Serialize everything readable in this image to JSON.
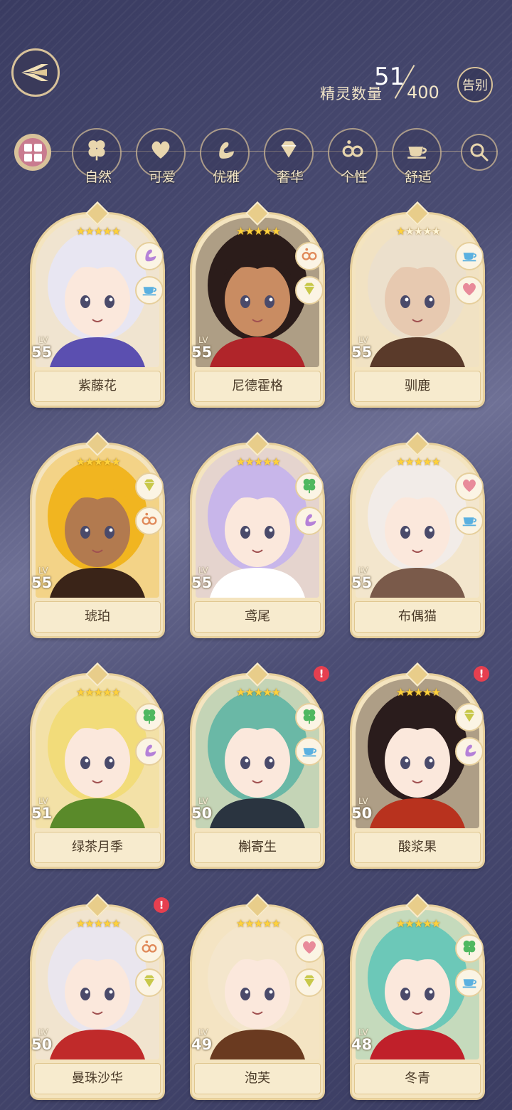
{
  "header": {
    "spirit_count_label": "精灵数量",
    "spirit_count": "51",
    "spirit_max": "400",
    "farewell_label": "告别"
  },
  "filters": [
    {
      "label": "自然",
      "icon": "clover-icon"
    },
    {
      "label": "可爱",
      "icon": "heart-icon"
    },
    {
      "label": "优雅",
      "icon": "swan-icon"
    },
    {
      "label": "奢华",
      "icon": "diamond-icon"
    },
    {
      "label": "个性",
      "icon": "glasses-icon"
    },
    {
      "label": "舒适",
      "icon": "teacup-icon"
    }
  ],
  "cards": [
    {
      "name": "紫藤花",
      "level": "55",
      "stars": 5,
      "lit_stars": 5,
      "traits": [
        "swan-icon",
        "teacup-icon"
      ],
      "alert": false,
      "hair": "#e8e6f2",
      "skin": "#fbe8dc",
      "accent": "#5b4fb0"
    },
    {
      "name": "尼德霍格",
      "level": "55",
      "stars": 5,
      "lit_stars": 5,
      "traits": [
        "glasses-icon",
        "diamond-icon"
      ],
      "alert": false,
      "hair": "#2b1c1a",
      "skin": "#c98c62",
      "accent": "#b0252a"
    },
    {
      "name": "驯鹿",
      "level": "55",
      "stars": 5,
      "lit_stars": 1,
      "traits": [
        "teacup-icon",
        "heart-icon"
      ],
      "alert": false,
      "hair": "#ece0cc",
      "skin": "#e7c9b0",
      "accent": "#5a3a2a"
    },
    {
      "name": "琥珀",
      "level": "55",
      "stars": 5,
      "lit_stars": 5,
      "traits": [
        "diamond-icon",
        "glasses-icon"
      ],
      "alert": false,
      "hair": "#f1b520",
      "skin": "#b27a4f",
      "accent": "#3a2418"
    },
    {
      "name": "鸢尾",
      "level": "55",
      "stars": 5,
      "lit_stars": 5,
      "traits": [
        "clover-icon",
        "swan-icon"
      ],
      "alert": false,
      "hair": "#c8b6ea",
      "skin": "#fbe8dc",
      "accent": "#ffffff"
    },
    {
      "name": "布偶猫",
      "level": "55",
      "stars": 5,
      "lit_stars": 5,
      "traits": [
        "heart-icon",
        "teacup-icon"
      ],
      "alert": false,
      "hair": "#f2ece8",
      "skin": "#fbe8dc",
      "accent": "#7a5a4a"
    },
    {
      "name": "绿茶月季",
      "level": "51",
      "stars": 5,
      "lit_stars": 5,
      "traits": [
        "clover-icon",
        "swan-icon"
      ],
      "alert": false,
      "hair": "#f2dc7a",
      "skin": "#fbe8dc",
      "accent": "#5a8a2a"
    },
    {
      "name": "槲寄生",
      "level": "50",
      "stars": 5,
      "lit_stars": 5,
      "traits": [
        "clover-icon",
        "teacup-icon"
      ],
      "alert": true,
      "hair": "#6ab8a6",
      "skin": "#fbe8dc",
      "accent": "#2a3440"
    },
    {
      "name": "酸浆果",
      "level": "50",
      "stars": 5,
      "lit_stars": 5,
      "traits": [
        "diamond-icon",
        "swan-icon"
      ],
      "alert": true,
      "hair": "#2a1c1c",
      "skin": "#fbe8dc",
      "accent": "#b8321e"
    },
    {
      "name": "曼珠沙华",
      "level": "50",
      "stars": 5,
      "lit_stars": 5,
      "traits": [
        "glasses-icon",
        "diamond-icon"
      ],
      "alert": true,
      "hair": "#eae6ee",
      "skin": "#fbe8dc",
      "accent": "#c02a2a"
    },
    {
      "name": "泡芙",
      "level": "49",
      "stars": 5,
      "lit_stars": 5,
      "traits": [
        "heart-icon",
        "diamond-icon"
      ],
      "alert": false,
      "hair": "#f4e6cc",
      "skin": "#fbe8dc",
      "accent": "#6a3a20"
    },
    {
      "name": "冬青",
      "level": "48",
      "stars": 5,
      "lit_stars": 5,
      "traits": [
        "clover-icon",
        "teacup-icon"
      ],
      "alert": false,
      "hair": "#6cc8b8",
      "skin": "#fbe8dc",
      "accent": "#c0202a"
    }
  ],
  "colors": {
    "gold": "#d8c29a",
    "card_bg": "#f4e4bf",
    "star": "#ffd23c",
    "alert": "#e63f4f",
    "active_filter": "#c97b8f"
  },
  "lv_label": "LV"
}
